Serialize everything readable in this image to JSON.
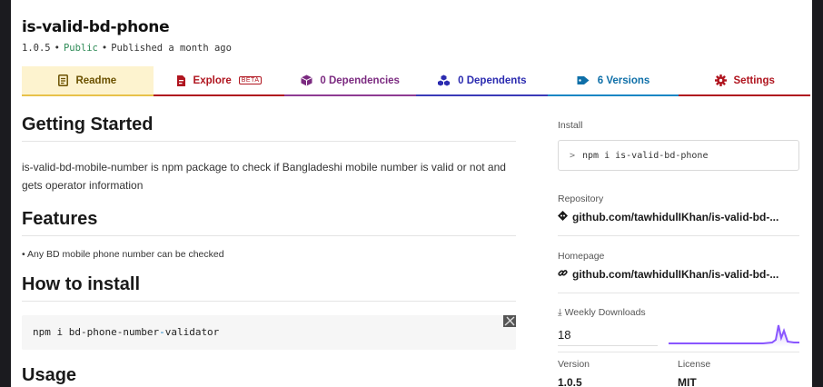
{
  "package": {
    "name": "is-valid-bd-phone",
    "version": "1.0.5",
    "visibility": "Public",
    "published": "Published a month ago"
  },
  "tabs": [
    {
      "label": "Readme",
      "icon": "readme-icon",
      "color": "#6b5100"
    },
    {
      "label": "Explore",
      "icon": "explore-icon",
      "badge": "BETA",
      "color": "#b0151f"
    },
    {
      "label": "0 Dependencies",
      "icon": "box-icon",
      "color": "#7b2a80"
    },
    {
      "label": "0 Dependents",
      "icon": "cubes-icon",
      "color": "#2b2bb0"
    },
    {
      "label": "6 Versions",
      "icon": "tag-icon",
      "color": "#0e6fa8"
    },
    {
      "label": "Settings",
      "icon": "gear-icon",
      "color": "#b0151f"
    }
  ],
  "readme": {
    "getting_started_heading": "Getting Started",
    "intro_text": "is-valid-bd-mobile-number is npm package to check if Bangladeshi mobile number is valid or not and gets operator information",
    "features_heading": "Features",
    "feature_items": [
      "Any BD mobile phone number can be checked"
    ],
    "install_heading": "How to install",
    "code_prefix": "npm i bd-phone-number",
    "code_highlight": "-",
    "code_suffix": "validator",
    "usage_heading": "Usage"
  },
  "sidebar": {
    "install_label": "Install",
    "install_prompt": ">",
    "install_command": "npm i is-valid-bd-phone",
    "repository_label": "Repository",
    "repository_link": "github.com/tawhidulIKhan/is-valid-bd-...",
    "homepage_label": "Homepage",
    "homepage_link": "github.com/tawhidulIKhan/is-valid-bd-...",
    "weekly_downloads_label": "Weekly Downloads",
    "weekly_downloads_value": "18",
    "version_label": "Version",
    "version_value": "1.0.5",
    "license_label": "License",
    "license_value": "MIT"
  },
  "colors": {
    "sparkline": "#8956ff",
    "public": "#2e8b57"
  }
}
